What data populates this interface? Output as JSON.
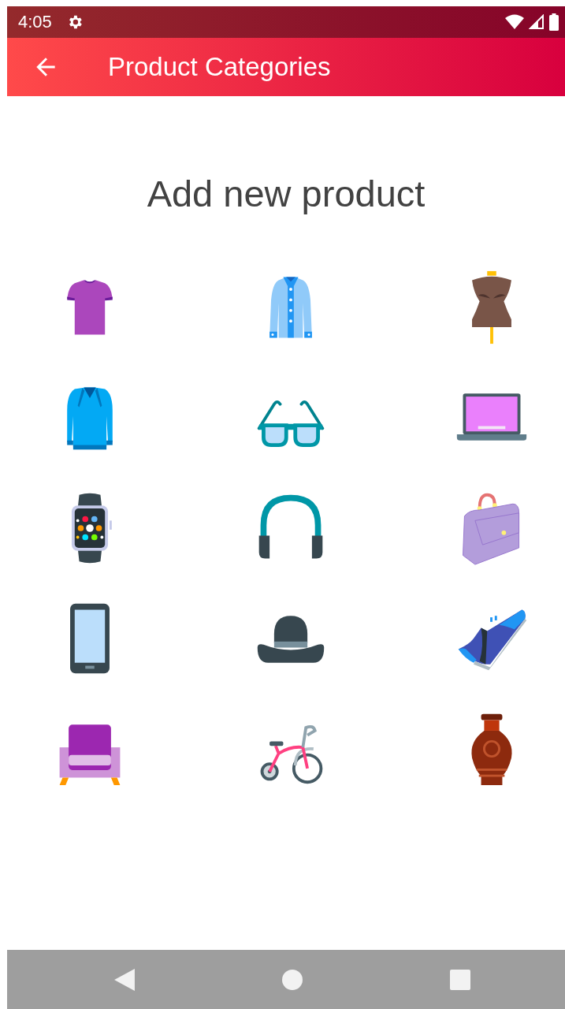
{
  "status_bar": {
    "time": "4:05"
  },
  "app_bar": {
    "title": "Product Categories"
  },
  "heading": "Add new product",
  "categories": [
    {
      "kind": "tshirt"
    },
    {
      "kind": "shirt"
    },
    {
      "kind": "mannequin"
    },
    {
      "kind": "sweater"
    },
    {
      "kind": "glasses"
    },
    {
      "kind": "laptop"
    },
    {
      "kind": "smartwatch"
    },
    {
      "kind": "headphones"
    },
    {
      "kind": "handbag"
    },
    {
      "kind": "smartphone"
    },
    {
      "kind": "hat"
    },
    {
      "kind": "sneaker"
    },
    {
      "kind": "armchair"
    },
    {
      "kind": "tricycle"
    },
    {
      "kind": "vase"
    }
  ]
}
